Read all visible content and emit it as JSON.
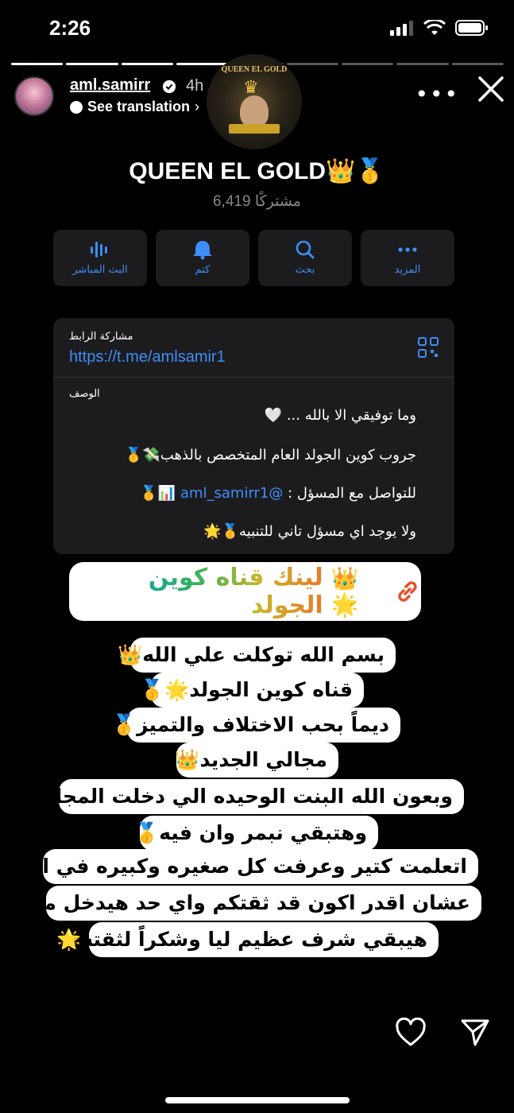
{
  "status_bar": {
    "time": "2:26"
  },
  "story": {
    "username": "aml.samirr",
    "time_ago": "4h",
    "see_translation": "See translation",
    "more": "•••"
  },
  "channel": {
    "logo_text": "QUEEN EL GOLD",
    "title": "QUEEN EL GOLD👑🥇",
    "subscribers": "6,419 مشتركًا",
    "actions": [
      {
        "label": "البث المباشر",
        "icon": "audio-waveform-icon"
      },
      {
        "label": "كتم",
        "icon": "bell-icon"
      },
      {
        "label": "بحث",
        "icon": "search-icon"
      },
      {
        "label": "المزيد",
        "icon": "ellipsis-icon"
      }
    ],
    "share_label": "مشاركة الرابط",
    "share_url": "https://t.me/amlsamir1",
    "description_label": "الوصف",
    "description": {
      "line1": "وما توفيقي الا بالله ... 🤍",
      "line2": "جروب كوين الجولد العام المتخصص بالذهب💸🥇",
      "line3_prefix": "للتواصل مع المسؤل : ",
      "line3_mention": "@aml_samirr1",
      "line3_suffix": " 📊🥇",
      "line4": "ولا يوجد اي مسؤل تاني للتنبيه🥇🌟"
    }
  },
  "sticker": {
    "text": "لينك قناه كوين الجولد",
    "emojis": "👑🌟"
  },
  "message_lines": [
    "بسم الله توكلت علي الله👑",
    "قناه كوين الجولد🌟🥇",
    "ديماً بحب الاختلاف والتميز🥇",
    "مجالي الجديد👑",
    "وبعون الله البنت الوحيده الي دخلت المجال دا",
    "وهتبقي نبمر وان فيه🥇",
    "اتعلمت كتير وعرفت كل صغيره وكبيره في المجال",
    "عشان اقدر اكون قد ثقتكم واي حد هيدخل معايا",
    "هيبقي شرف عظيم ليا وشكراً لثقته🌟"
  ],
  "colors": {
    "accent": "#3e8ef7",
    "card": "#1c1c1e",
    "background": "#000000"
  }
}
